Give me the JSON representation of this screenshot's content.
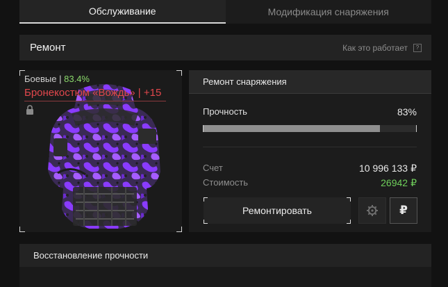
{
  "tabs": [
    {
      "label": "Обслуживание",
      "active": true
    },
    {
      "label": "Модификация снаряжения",
      "active": false
    }
  ],
  "header": {
    "title": "Ремонт",
    "help_label": "Как это работает",
    "help_icon": "?"
  },
  "item": {
    "category": "Боевые",
    "separator": "|",
    "durability_pct": "83.4%",
    "name": "Бронекостюм «Вождь» | +15",
    "locked": true
  },
  "repair": {
    "title": "Ремонт снаряжения",
    "durability_label": "Прочность",
    "durability_value": "83%",
    "durability_fraction": 0.83,
    "account_label": "Счет",
    "account_value": "10 996 133",
    "cost_label": "Стоимость",
    "cost_value": "26942",
    "currency_symbol": "₽",
    "repair_button": "Ремонтировать",
    "gear_icon": "gear-icon",
    "ruble_icon": "ruble-icon"
  },
  "restore": {
    "title": "Восстановление прочности"
  },
  "colors": {
    "accent_green": "#6fcf5b",
    "item_red": "#e0474c",
    "armor_purple": "#8a3bff"
  }
}
